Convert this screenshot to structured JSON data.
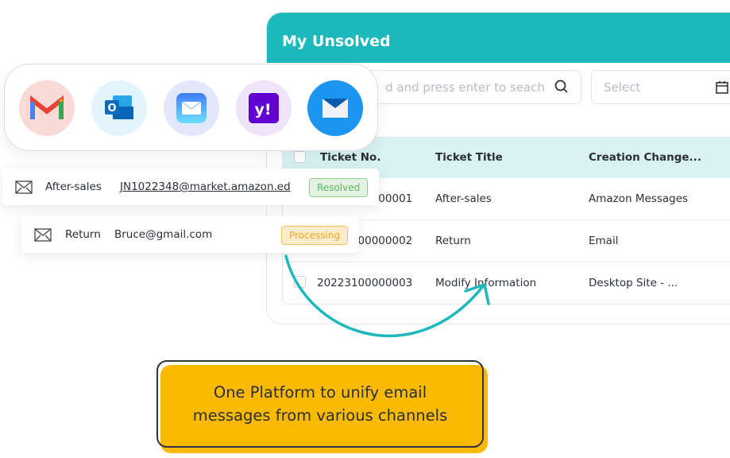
{
  "panel": {
    "title": "My Unsolved",
    "search_placeholder": "d and press enter to seach",
    "select_placeholder": "Select",
    "columns": [
      "Ticket No.",
      "Ticket Title",
      "Creation Change..."
    ],
    "rows": [
      {
        "ticket_no": "20223100000001",
        "title": "After-sales",
        "channel": "Amazon Messages"
      },
      {
        "ticket_no": "20223100000002",
        "title": "Return",
        "channel": "Email"
      },
      {
        "ticket_no": "20223100000003",
        "title": "Modify Information",
        "channel": "Desktop Site - ..."
      }
    ]
  },
  "channels": [
    {
      "icon": "gmail-icon",
      "bg": "#fadad7"
    },
    {
      "icon": "outlook-icon",
      "bg": "#e2f5fc"
    },
    {
      "icon": "apple-mail-icon",
      "bg": "#e3e7fb"
    },
    {
      "icon": "yahoo-mail-icon",
      "bg": "#efe4f9"
    },
    {
      "icon": "mail-app-icon",
      "bg": "#1a96f0"
    }
  ],
  "messages": [
    {
      "type": "After-sales",
      "email": "JN1022348@market.amazon.ed",
      "status": "Resolved",
      "status_color": "#5cb85c"
    },
    {
      "type": "Return",
      "email": "Bruce@gmail.com",
      "status": "Processing",
      "status_color": "#f5a623"
    }
  ],
  "cta": {
    "text": "One Platform to unify email messages from various channels"
  },
  "colors": {
    "accent": "#1db8bc",
    "cta": "#fbb900"
  }
}
